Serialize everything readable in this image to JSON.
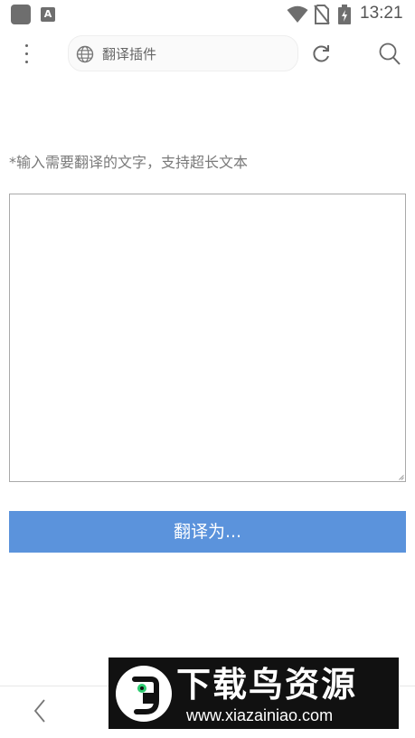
{
  "status_bar": {
    "time": "13:21",
    "icons": [
      "app-square-icon",
      "a-notification-icon",
      "wifi-icon",
      "no-sim-icon",
      "battery-charging-icon"
    ]
  },
  "toolbar": {
    "menu_icon": "vertical-dots-icon",
    "url_icon": "globe-icon",
    "url_text": "翻译插件",
    "reload_icon": "reload-icon",
    "search_icon": "search-icon"
  },
  "content": {
    "prompt": "*输入需要翻译的文字，支持超长文本",
    "textarea_value": "",
    "translate_button": "翻译为..."
  },
  "bottom_nav": {
    "back_icon": "chevron-left-icon"
  },
  "watermark": {
    "title": "下载鸟资源",
    "url": "www.xiazainiao.com"
  },
  "colors": {
    "primary_button": "#5b93dc",
    "icon_gray": "#666666",
    "watermark_bg": "#111111"
  }
}
